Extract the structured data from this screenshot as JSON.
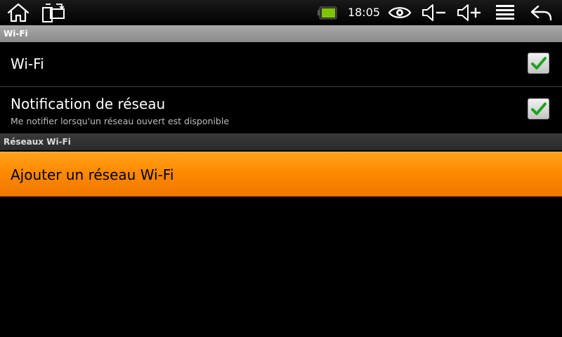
{
  "status_bar": {
    "time": "18:05",
    "icons": {
      "home": "home-icon",
      "rotate": "screen-rotate-icon",
      "battery": "battery-icon",
      "eye": "eye-icon",
      "volume_down": "volume-down-icon",
      "volume_up": "volume-up-icon",
      "menu": "menu-icon",
      "back": "back-icon"
    },
    "battery_color": "#7ec400"
  },
  "wifi_section": {
    "header": "Wi-Fi",
    "items": [
      {
        "title": "Wi-Fi",
        "summary": "",
        "checked": true
      },
      {
        "title": "Notification de réseau",
        "summary": "Me notifier lorsqu'un réseau ouvert est disponible",
        "checked": true
      }
    ]
  },
  "networks_section": {
    "header": "Réseaux Wi-Fi",
    "add_network": "Ajouter un réseau Wi-Fi"
  },
  "colors": {
    "accent_selected": "#ff8a00",
    "checkmark": "#1fa31f"
  }
}
